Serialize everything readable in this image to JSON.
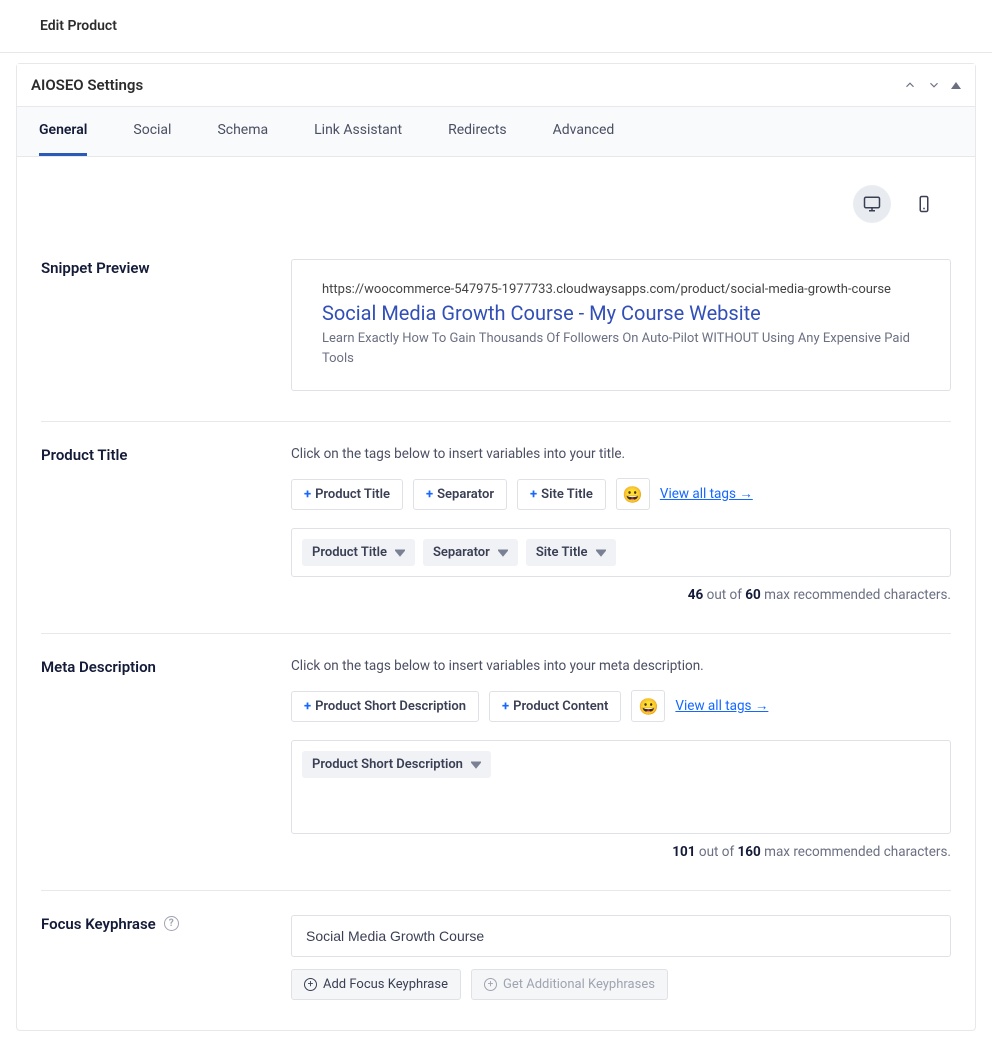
{
  "page_title": "Edit Product",
  "panel_title": "AIOSEO Settings",
  "tabs": {
    "general": "General",
    "social": "Social",
    "schema": "Schema",
    "link_assistant": "Link Assistant",
    "redirects": "Redirects",
    "advanced": "Advanced"
  },
  "snippet": {
    "label": "Snippet Preview",
    "url": "https://woocommerce-547975-1977733.cloudwaysapps.com/product/social-media-growth-course",
    "title": "Social Media Growth Course - My Course Website",
    "description": "Learn Exactly How To Gain Thousands Of Followers On Auto-Pilot WITHOUT Using Any Expensive Paid Tools"
  },
  "product_title": {
    "label": "Product Title",
    "hint": "Click on the tags below to insert variables into your title.",
    "tags": {
      "product_title": "Product Title",
      "separator": "Separator",
      "site_title": "Site Title"
    },
    "view_all": "View all tags →",
    "chips": {
      "product_title": "Product Title",
      "separator": "Separator",
      "site_title": "Site Title"
    },
    "counter": {
      "used": "46",
      "mid": " out of ",
      "max": "60",
      "suffix": " max recommended characters."
    }
  },
  "meta_description": {
    "label": "Meta Description",
    "hint": "Click on the tags below to insert variables into your meta description.",
    "tags": {
      "short_desc": "Product Short Description",
      "content": "Product Content"
    },
    "view_all": "View all tags →",
    "chips": {
      "short_desc": "Product Short Description"
    },
    "counter": {
      "used": "101",
      "mid": " out of ",
      "max": "160",
      "suffix": " max recommended characters."
    }
  },
  "focus_keyphrase": {
    "label": "Focus Keyphrase",
    "value": "Social Media Growth Course",
    "add_btn": "Add Focus Keyphrase",
    "get_btn": "Get Additional Keyphrases"
  }
}
